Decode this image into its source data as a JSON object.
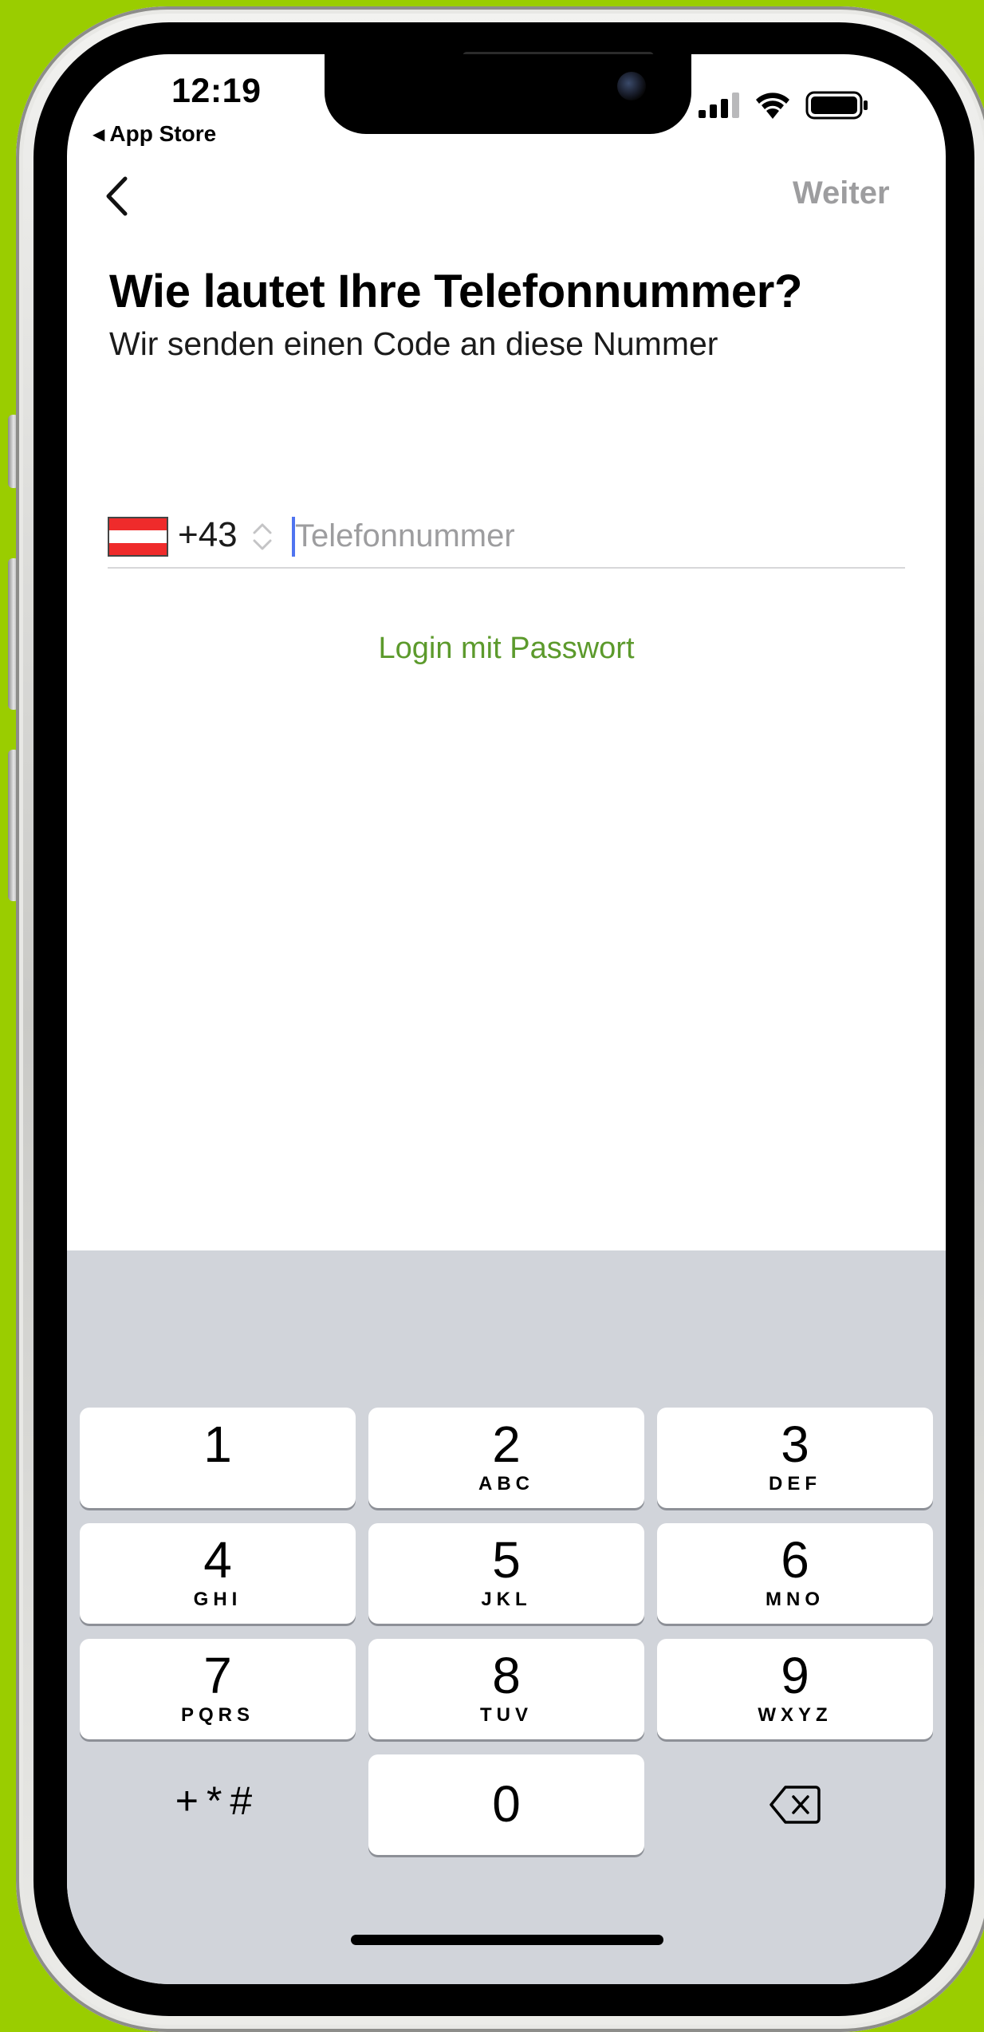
{
  "status_bar": {
    "time": "12:19",
    "back_app": "App Store"
  },
  "nav": {
    "next_label": "Weiter"
  },
  "header": {
    "title": "Wie lautet Ihre Telefonnummer?",
    "subtitle": "Wir senden einen Code an diese Nummer"
  },
  "phone_field": {
    "dial_code": "+43",
    "placeholder": "Telefonnummer",
    "value": ""
  },
  "login_link": "Login mit Passwort",
  "keypad": {
    "keys": [
      {
        "num": "1",
        "sub": ""
      },
      {
        "num": "2",
        "sub": "ABC"
      },
      {
        "num": "3",
        "sub": "DEF"
      },
      {
        "num": "4",
        "sub": "GHI"
      },
      {
        "num": "5",
        "sub": "JKL"
      },
      {
        "num": "6",
        "sub": "MNO"
      },
      {
        "num": "7",
        "sub": "PQRS"
      },
      {
        "num": "8",
        "sub": "TUV"
      },
      {
        "num": "9",
        "sub": "WXYZ"
      },
      {
        "num": "0",
        "sub": ""
      }
    ],
    "symbols": "+*#"
  },
  "colors": {
    "background": "#9acd00",
    "accent_link": "#5c9a2c",
    "disabled_text": "#9d9d9f",
    "keypad_bg": "#d1d4da",
    "flag_red": "#ef2b2b"
  }
}
